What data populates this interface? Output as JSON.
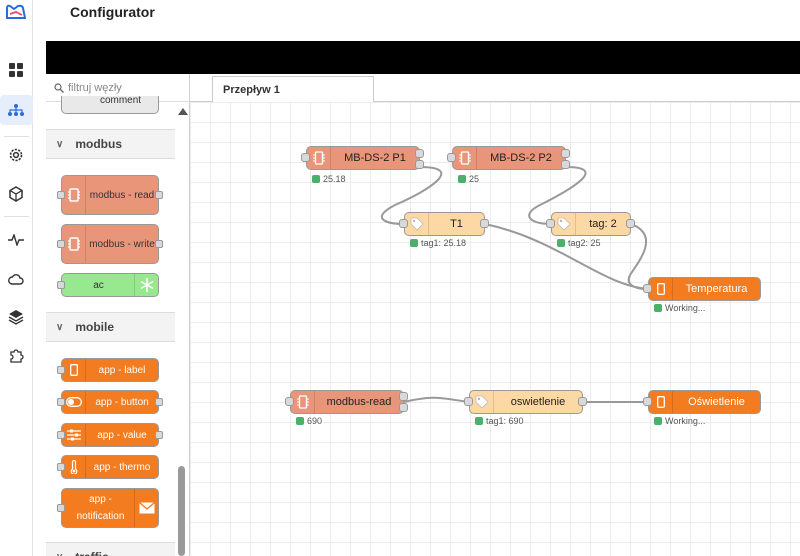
{
  "app": {
    "title": "Configurator"
  },
  "rail": {
    "items": [
      {
        "icon": "dashboard-icon"
      },
      {
        "icon": "flow-icon",
        "active": true
      },
      {
        "icon": "gear-icon"
      },
      {
        "icon": "cube-icon"
      },
      {
        "icon": "activity-icon"
      },
      {
        "icon": "cloud-icon"
      },
      {
        "icon": "layers-icon"
      },
      {
        "icon": "puzzle-icon"
      }
    ]
  },
  "palette": {
    "filter_placeholder": "filtruj węzły",
    "partial_top_label": "comment",
    "categories": [
      {
        "name": "modbus",
        "nodes": [
          "modbus - read",
          "modbus - write",
          "ac"
        ]
      },
      {
        "name": "mobile",
        "nodes": [
          "app - label",
          "app - button",
          "app - value",
          "app - thermo",
          "app - notification"
        ]
      }
    ],
    "partial_bottom_label": "traffic"
  },
  "tabs": [
    {
      "label": "Przepływ 1"
    }
  ],
  "flow": {
    "nodes": [
      {
        "id": "mb1",
        "label": "MB-DS-2 P1",
        "status": "25.18"
      },
      {
        "id": "mb2",
        "label": "MB-DS-2 P2",
        "status": "25"
      },
      {
        "id": "t1",
        "label": "T1",
        "status": "tag1: 25.18"
      },
      {
        "id": "tag2",
        "label": "tag: 2",
        "status": "tag2: 25"
      },
      {
        "id": "temp",
        "label": "Temperatura",
        "status": "Working..."
      },
      {
        "id": "mbr",
        "label": "modbus-read",
        "status": "690"
      },
      {
        "id": "osw",
        "label": "oswietlenie",
        "status": "tag1: 690"
      },
      {
        "id": "oswo",
        "label": "Oświetlenie",
        "status": "Working..."
      }
    ]
  },
  "colors": {
    "modbus": "#e8957a",
    "tag": "#fcd9a4",
    "app": "#f47c20",
    "ac": "#98e890",
    "status_ok": "#4caf6a"
  }
}
